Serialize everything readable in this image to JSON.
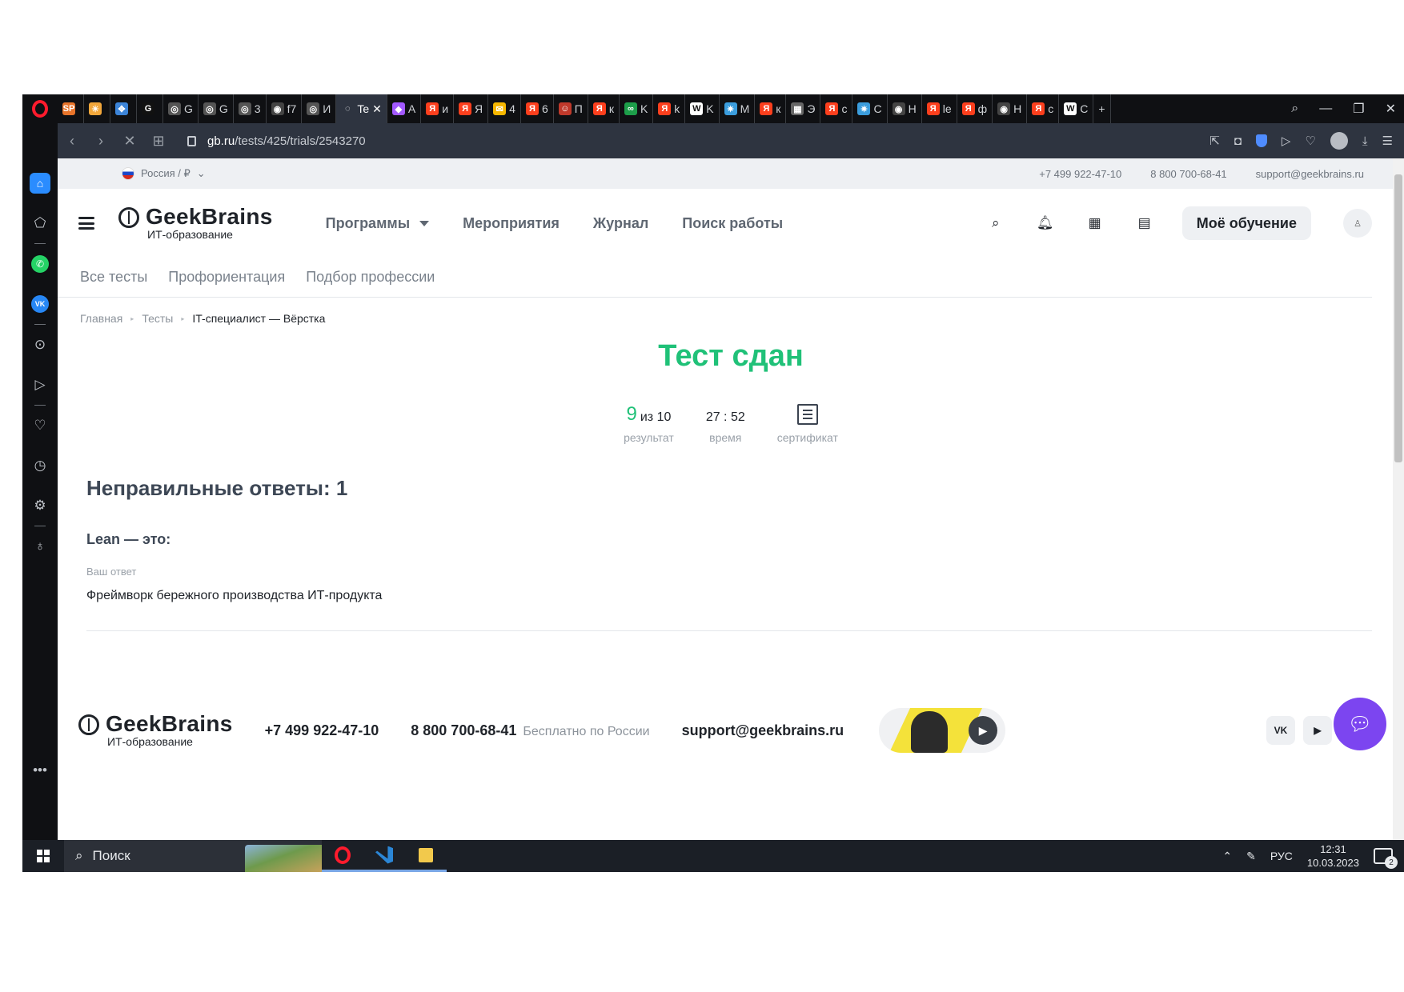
{
  "browser": {
    "tabs": [
      {
        "icon": "SP",
        "color": "#e8742a",
        "label": ""
      },
      {
        "icon": "☀",
        "color": "#f2a73b",
        "label": ""
      },
      {
        "icon": "✥",
        "color": "#3c84d8",
        "label": ""
      },
      {
        "icon": "G",
        "color": "#111111",
        "label": ""
      },
      {
        "icon": "◎",
        "color": "#555555",
        "label": "G"
      },
      {
        "icon": "◎",
        "color": "#555555",
        "label": "G"
      },
      {
        "icon": "◎",
        "color": "#555555",
        "label": "3"
      },
      {
        "icon": "◉",
        "color": "#444444",
        "label": "f7"
      },
      {
        "icon": "◎",
        "color": "#555555",
        "label": "И"
      },
      {
        "icon": "◌",
        "color": "#2e3440",
        "label": "Te",
        "active": true
      },
      {
        "icon": "◆",
        "color": "#a259ff",
        "label": "А"
      },
      {
        "icon": "Я",
        "color": "#fc3f1d",
        "label": "и"
      },
      {
        "icon": "Я",
        "color": "#fc3f1d",
        "label": "Я"
      },
      {
        "icon": "✉",
        "color": "#f6b700",
        "label": "4"
      },
      {
        "icon": "Я",
        "color": "#fc3f1d",
        "label": "6"
      },
      {
        "icon": "☺",
        "color": "#c0392b",
        "label": "П"
      },
      {
        "icon": "Я",
        "color": "#fc3f1d",
        "label": "к"
      },
      {
        "icon": "∞",
        "color": "#1d9e4a",
        "label": "K"
      },
      {
        "icon": "Я",
        "color": "#fc3f1d",
        "label": "k"
      },
      {
        "icon": "W",
        "color": "#ffffff",
        "label": "K"
      },
      {
        "icon": "✷",
        "color": "#3b9ddd",
        "label": "M"
      },
      {
        "icon": "Я",
        "color": "#fc3f1d",
        "label": "к"
      },
      {
        "icon": "▦",
        "color": "#666666",
        "label": "Э"
      },
      {
        "icon": "Я",
        "color": "#fc3f1d",
        "label": "с"
      },
      {
        "icon": "✷",
        "color": "#3b9ddd",
        "label": "C"
      },
      {
        "icon": "◉",
        "color": "#444444",
        "label": "H"
      },
      {
        "icon": "Я",
        "color": "#fc3f1d",
        "label": "le"
      },
      {
        "icon": "Я",
        "color": "#fc3f1d",
        "label": "ф"
      },
      {
        "icon": "◉",
        "color": "#444444",
        "label": "H"
      },
      {
        "icon": "Я",
        "color": "#fc3f1d",
        "label": "с"
      },
      {
        "icon": "W",
        "color": "#ffffff",
        "label": "C"
      }
    ],
    "url_host": "gb.ru",
    "url_path": "/tests/425/trials/2543270"
  },
  "site": {
    "region": "Россия / ₽",
    "phone1": "+7 499 922-47-10",
    "phone2": "8 800 700-68-41",
    "email": "support@geekbrains.ru",
    "logo_name": "GeekBrains",
    "logo_sub": "ИТ-образование",
    "nav": [
      "Программы",
      "Мероприятия",
      "Журнал",
      "Поиск работы"
    ],
    "my_learning": "Моё обучение",
    "subnav": [
      "Все тесты",
      "Профориентация",
      "Подбор профессии"
    ],
    "breadcrumb": [
      "Главная",
      "Тесты",
      "IT-специалист — Вёрстка"
    ]
  },
  "result": {
    "title": "Тест сдан",
    "score": "9",
    "score_of": "из 10",
    "score_label": "результат",
    "time": "27 : 52",
    "time_label": "время",
    "cert_label": "сертификат",
    "wrong_title": "Неправильные ответы: 1",
    "question": "Lean — это:",
    "your_answer_label": "Ваш ответ",
    "your_answer": "Фреймворк бережного производства ИТ-продукта"
  },
  "footer": {
    "phone1": "+7 499 922-47-10",
    "phone2": "8 800 700-68-41",
    "free_label": "Бесплатно по России",
    "email": "support@geekbrains.ru",
    "social_vk": "VK",
    "social_yt": "▶"
  },
  "taskbar": {
    "search_placeholder": "Поиск",
    "lang": "РУС",
    "time": "12:31",
    "date": "10.03.2023",
    "notifications": "2"
  }
}
